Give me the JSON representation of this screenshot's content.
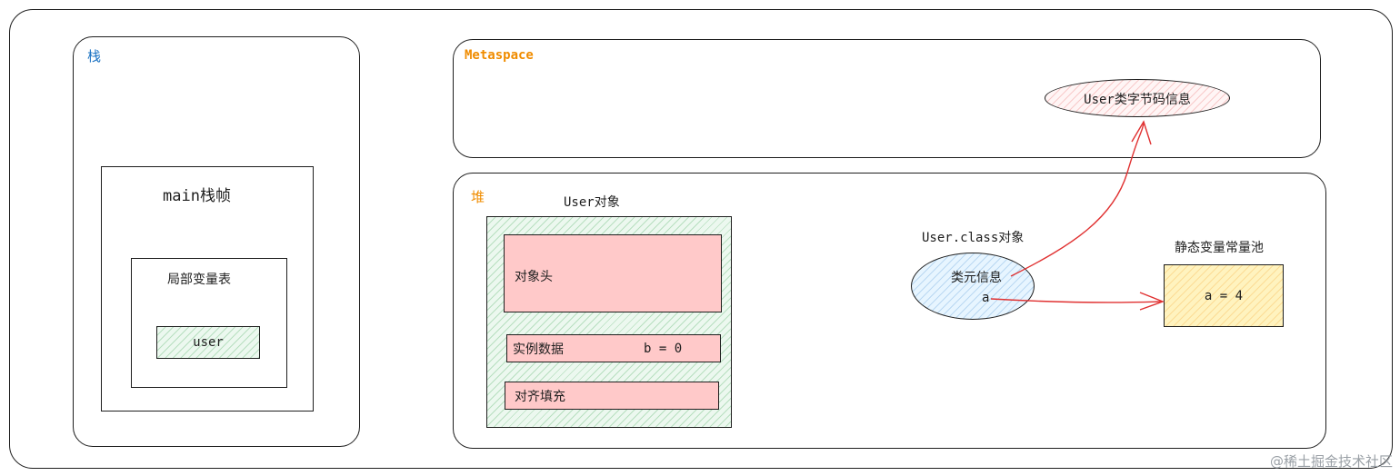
{
  "colors": {
    "stroke": "#1e1e1e",
    "stack_label": "#1971c2",
    "metaspace_label": "#f08c00",
    "heap_label": "#f08c00",
    "arrow": "#e03131",
    "green_fill": "#b2f2bb",
    "pink_fill": "#ffc9c9",
    "yellow_fill": "#fff3bf",
    "blue_fill": "#a5d8ff"
  },
  "stack": {
    "label": "栈",
    "frame": {
      "title": "main栈帧",
      "local_vars": {
        "title": "局部变量表",
        "var": "user"
      }
    }
  },
  "metaspace": {
    "label": "Metaspace",
    "bytecode": "User类字节码信息"
  },
  "heap": {
    "label": "堆",
    "user_object": {
      "title": "User对象",
      "header": "对象头",
      "instance_data": "实例数据",
      "instance_value": "b = 0",
      "padding": "对齐填充"
    },
    "class_object": {
      "title": "User.class对象",
      "meta": "类元信息",
      "field": "a"
    },
    "static_pool": {
      "title": "静态变量常量池",
      "value": "a = 4"
    }
  },
  "watermark": "@稀土掘金技术社区"
}
